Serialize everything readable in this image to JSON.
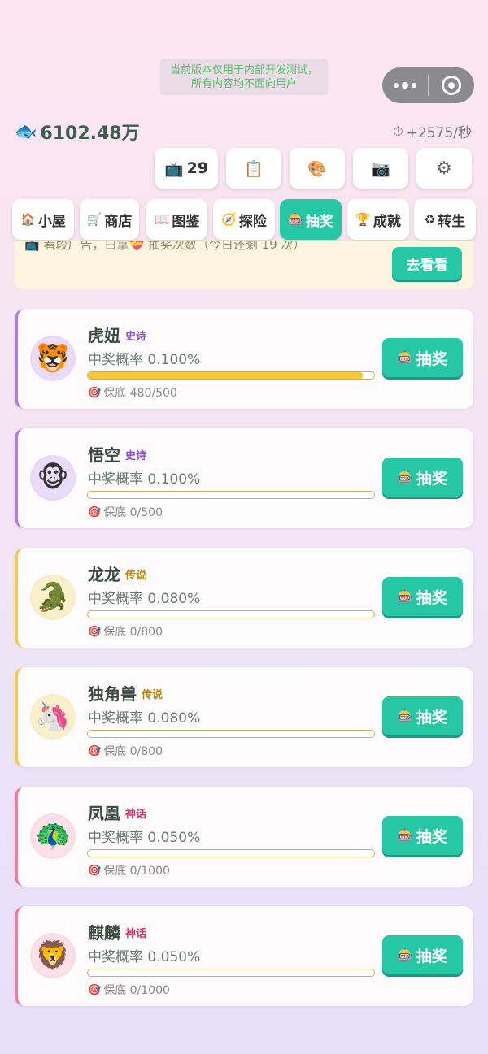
{
  "dev_notice": {
    "line1": "当前版本仅用于内部开发测试，",
    "line2": "所有内容均不面向用户"
  },
  "status": {
    "fish_icon": "🐟",
    "coins": "6102.48万",
    "timer_icon": "⏱",
    "rate": "+2575/秒"
  },
  "toolbar": {
    "tv_icon": "📺",
    "tv_count": "29",
    "clipboard_icon": "📋",
    "palette_icon": "🎨",
    "camera_icon": "📷",
    "gear_icon": "⚙"
  },
  "nav": [
    {
      "icon": "🏠",
      "label": "小屋"
    },
    {
      "icon": "🛒",
      "label": "商店"
    },
    {
      "icon": "📖",
      "label": "图鉴"
    },
    {
      "icon": "🧭",
      "label": "探险"
    },
    {
      "icon": "🎰",
      "label": "抽奖",
      "active": true
    },
    {
      "icon": "🏆",
      "label": "成就"
    },
    {
      "icon": "♻",
      "label": "转生"
    }
  ],
  "ad_banner": {
    "text": "📺 看段广告，白拿💝 抽奖次数（今日还剩 19 次）",
    "button": "去看看"
  },
  "prizes": [
    {
      "avatar": "🐯",
      "name": "虎妞",
      "tier": "史诗",
      "prob": "中奖概率 0.100%",
      "progress": 0.96,
      "pity": "保底 480/500",
      "button": "抽奖"
    },
    {
      "avatar": "🐵",
      "name": "悟空",
      "tier": "史诗",
      "prob": "中奖概率 0.100%",
      "progress": 0,
      "pity": "保底 0/500",
      "button": "抽奖"
    },
    {
      "avatar": "🐊",
      "name": "龙龙",
      "tier": "传说",
      "prob": "中奖概率 0.080%",
      "progress": 0,
      "pity": "保底 0/800",
      "button": "抽奖"
    },
    {
      "avatar": "🦄",
      "name": "独角兽",
      "tier": "传说",
      "prob": "中奖概率 0.080%",
      "progress": 0,
      "pity": "保底 0/800",
      "button": "抽奖"
    },
    {
      "avatar": "🦚",
      "name": "凤凰",
      "tier": "神话",
      "prob": "中奖概率 0.050%",
      "progress": 0,
      "pity": "保底 0/1000",
      "button": "抽奖"
    },
    {
      "avatar": "🦁",
      "name": "麒麟",
      "tier": "神话",
      "prob": "中奖概率 0.050%",
      "progress": 0,
      "pity": "保底 0/1000",
      "button": "抽奖"
    }
  ],
  "icons": {
    "target": "🎯",
    "slot": "🎰"
  }
}
